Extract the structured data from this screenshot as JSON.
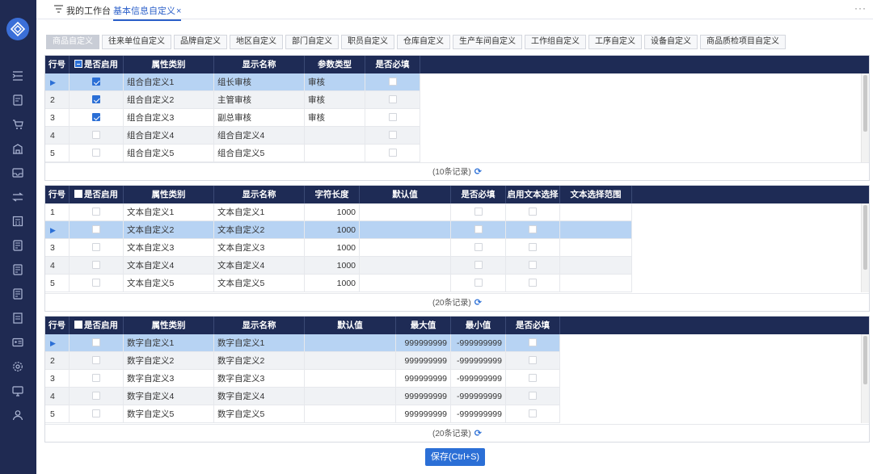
{
  "topbar": {
    "tab_workbench": "我的工作台",
    "tab_active": "基本信息自定义",
    "close": "×",
    "more": "···"
  },
  "subtabs": [
    "商品自定义",
    "往来单位自定义",
    "品牌自定义",
    "地区自定义",
    "部门自定义",
    "职员自定义",
    "仓库自定义",
    "生产车间自定义",
    "工作组自定义",
    "工序自定义",
    "设备自定义",
    "商品质检项目自定义"
  ],
  "sidebar_icons": [
    "menu-indent-icon",
    "document-icon",
    "cart-icon",
    "building-icon",
    "inbox-icon",
    "transfer-icon",
    "calculator-icon",
    "report-icon",
    "report-alt-icon",
    "report-list-icon",
    "list-icon",
    "id-card-icon",
    "settings-icon",
    "monitor-icon",
    "user-icon"
  ],
  "grid1": {
    "headers": [
      "行号",
      "是否启用",
      "属性类别",
      "显示名称",
      "参数类型",
      "是否必填"
    ],
    "rows": [
      {
        "no": "1",
        "enabled": true,
        "category": "组合自定义1",
        "name": "组长审核",
        "type": "审核",
        "required": false
      },
      {
        "no": "2",
        "enabled": true,
        "category": "组合自定义2",
        "name": "主管审核",
        "type": "审核",
        "required": false
      },
      {
        "no": "3",
        "enabled": true,
        "category": "组合自定义3",
        "name": "副总审核",
        "type": "审核",
        "required": false
      },
      {
        "no": "4",
        "enabled": false,
        "category": "组合自定义4",
        "name": "组合自定义4",
        "type": "",
        "required": false
      },
      {
        "no": "5",
        "enabled": false,
        "category": "组合自定义5",
        "name": "组合自定义5",
        "type": "",
        "required": false
      }
    ],
    "footer": "(10条记录)"
  },
  "grid2": {
    "headers": [
      "行号",
      "是否启用",
      "属性类别",
      "显示名称",
      "字符长度",
      "默认值",
      "是否必填",
      "启用文本选择",
      "文本选择范围"
    ],
    "rows": [
      {
        "no": "1",
        "enabled": false,
        "category": "文本自定义1",
        "name": "文本自定义1",
        "length": "1000",
        "default": "",
        "required": false,
        "text_select": false,
        "range": ""
      },
      {
        "no": "2",
        "enabled": false,
        "category": "文本自定义2",
        "name": "文本自定义2",
        "length": "1000",
        "default": "",
        "required": false,
        "text_select": false,
        "range": ""
      },
      {
        "no": "3",
        "enabled": false,
        "category": "文本自定义3",
        "name": "文本自定义3",
        "length": "1000",
        "default": "",
        "required": false,
        "text_select": false,
        "range": ""
      },
      {
        "no": "4",
        "enabled": false,
        "category": "文本自定义4",
        "name": "文本自定义4",
        "length": "1000",
        "default": "",
        "required": false,
        "text_select": false,
        "range": ""
      },
      {
        "no": "5",
        "enabled": false,
        "category": "文本自定义5",
        "name": "文本自定义5",
        "length": "1000",
        "default": "",
        "required": false,
        "text_select": false,
        "range": ""
      }
    ],
    "footer": "(20条记录)"
  },
  "grid3": {
    "headers": [
      "行号",
      "是否启用",
      "属性类别",
      "显示名称",
      "默认值",
      "最大值",
      "最小值",
      "是否必填"
    ],
    "rows": [
      {
        "no": "1",
        "enabled": false,
        "category": "数字自定义1",
        "name": "数字自定义1",
        "default": "",
        "max": "999999999",
        "min": "-999999999",
        "required": false
      },
      {
        "no": "2",
        "enabled": false,
        "category": "数字自定义2",
        "name": "数字自定义2",
        "default": "",
        "max": "999999999",
        "min": "-999999999",
        "required": false
      },
      {
        "no": "3",
        "enabled": false,
        "category": "数字自定义3",
        "name": "数字自定义3",
        "default": "",
        "max": "999999999",
        "min": "-999999999",
        "required": false
      },
      {
        "no": "4",
        "enabled": false,
        "category": "数字自定义4",
        "name": "数字自定义4",
        "default": "",
        "max": "999999999",
        "min": "-999999999",
        "required": false
      },
      {
        "no": "5",
        "enabled": false,
        "category": "数字自定义5",
        "name": "数字自定义5",
        "default": "",
        "max": "999999999",
        "min": "-999999999",
        "required": false
      }
    ],
    "footer": "(20条记录)"
  },
  "refresh_icon": "⟳",
  "selected_arrow": "▶",
  "save_label": "保存(Ctrl+S)",
  "colors": {
    "header": "#1e2b55",
    "sidebar": "#1f2a52",
    "accent": "#2b6fd6",
    "selected_row": "#b7d3f3"
  }
}
